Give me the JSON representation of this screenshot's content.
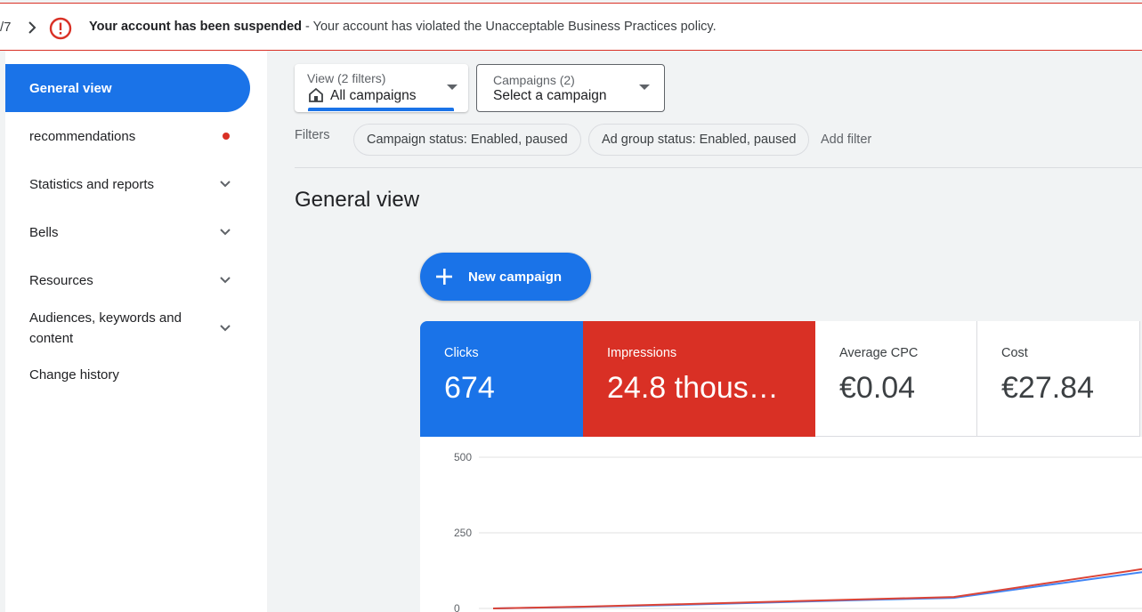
{
  "alert": {
    "pager": "/7",
    "title": "Your account has been suspended",
    "separator": " - ",
    "message": "Your account has violated the Unacceptable Business Practices policy."
  },
  "sidebar": {
    "items": [
      {
        "label": "General view"
      },
      {
        "label": "recommendations"
      },
      {
        "label": "Statistics and reports"
      },
      {
        "label": "Bells"
      },
      {
        "label": "Resources"
      },
      {
        "label": "Audiences, keywords and content"
      },
      {
        "label": "Change history"
      }
    ]
  },
  "view_filter": {
    "caption": "View (2 filters)",
    "value": "All campaigns"
  },
  "campaign_filter": {
    "caption": "Campaigns (2)",
    "value": "Select a campaign"
  },
  "filters": {
    "label": "Filters",
    "chips": [
      "Campaign status: Enabled, paused",
      "Ad group status: Enabled, paused"
    ],
    "add_label": "Add filter"
  },
  "page_title": "General view",
  "new_campaign_label": "New campaign",
  "metrics": [
    {
      "label": "Clicks",
      "value": "674"
    },
    {
      "label": "Impressions",
      "value": "24.8 thous…"
    },
    {
      "label": "Average CPC",
      "value": "€0.04"
    },
    {
      "label": "Cost",
      "value": "€27.84"
    }
  ],
  "colors": {
    "accent": "#1a73e8",
    "danger": "#d93025"
  },
  "chart_data": {
    "type": "line",
    "y_ticks": [
      "500",
      "250",
      "0"
    ],
    "ylim": [
      0,
      500
    ],
    "grid": true,
    "series": [
      {
        "color": "#4285f4",
        "values": [
          0,
          5,
          12,
          20,
          28,
          35,
          120
        ]
      },
      {
        "color": "#db4437",
        "values": [
          0,
          6,
          14,
          22,
          30,
          38,
          130
        ]
      }
    ]
  }
}
